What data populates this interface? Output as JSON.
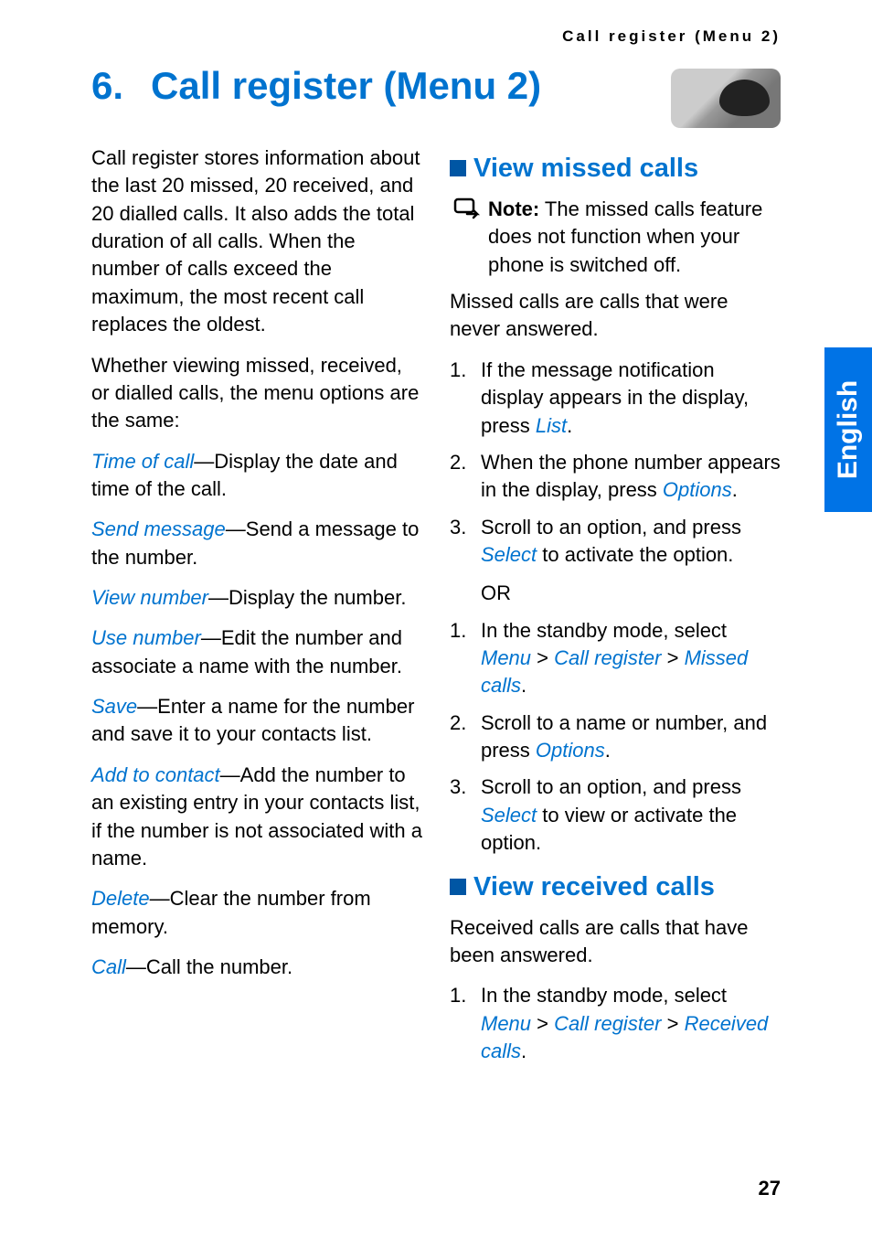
{
  "running_header": "Call register (Menu 2)",
  "chapter": {
    "num": "6.",
    "title": "Call register (Menu 2)"
  },
  "side_tab": "English",
  "page_number": "27",
  "left": {
    "intro": "Call register stores information about the last 20 missed, 20 received, and 20 dialled calls. It also adds the total duration of all calls. When the number of calls exceed the maximum, the most recent call replaces the oldest.",
    "lead": "Whether viewing missed, received, or dialled calls, the menu options are the same:",
    "items": [
      {
        "term": "Time of call",
        "desc": "—Display the date and time of the call."
      },
      {
        "term": "Send message",
        "desc": "—Send a message to the number."
      },
      {
        "term": "View number",
        "desc": "—Display the number."
      },
      {
        "term": "Use number",
        "desc": "—Edit the number and associate a name with the number."
      },
      {
        "term": "Save",
        "desc": "—Enter a name for the number and save it to your contacts list."
      },
      {
        "term": "Add to contact",
        "desc": "—Add the number to an existing entry in your contacts list, if the number is not associated with a name."
      },
      {
        "term": "Delete",
        "desc": "—Clear the number from memory."
      },
      {
        "term": "Call",
        "desc": "—Call the number."
      }
    ]
  },
  "right": {
    "sec1": {
      "title": "View missed calls",
      "note_label": "Note:",
      "note_text": " The missed calls feature does not function when your phone is switched off.",
      "p1": "Missed calls are calls that were never answered.",
      "stepsA": {
        "s1a": "If the message notification display appears in the display, press ",
        "s1b": "List",
        "s1c": ".",
        "s2a": "When the phone number appears in the display, press ",
        "s2b": "Options",
        "s2c": ".",
        "s3a": "Scroll to an option, and press ",
        "s3b": "Select",
        "s3c": " to activate the option."
      },
      "or": "OR",
      "stepsB": {
        "s1a": "In the standby mode, select ",
        "s1b": "Menu",
        "s1c": " > ",
        "s1d": "Call register",
        "s1e": " > ",
        "s1f": "Missed calls",
        "s1g": ".",
        "s2a": "Scroll to a name or number, and press ",
        "s2b": "Options",
        "s2c": ".",
        "s3a": "Scroll to an option, and press ",
        "s3b": "Select",
        "s3c": " to view or activate the option."
      }
    },
    "sec2": {
      "title": "View received calls",
      "p1": "Received calls are calls that have been answered.",
      "steps": {
        "s1a": "In the standby mode, select ",
        "s1b": "Menu",
        "s1c": " > ",
        "s1d": "Call register",
        "s1e": " > ",
        "s1f": "Received calls",
        "s1g": "."
      }
    }
  }
}
